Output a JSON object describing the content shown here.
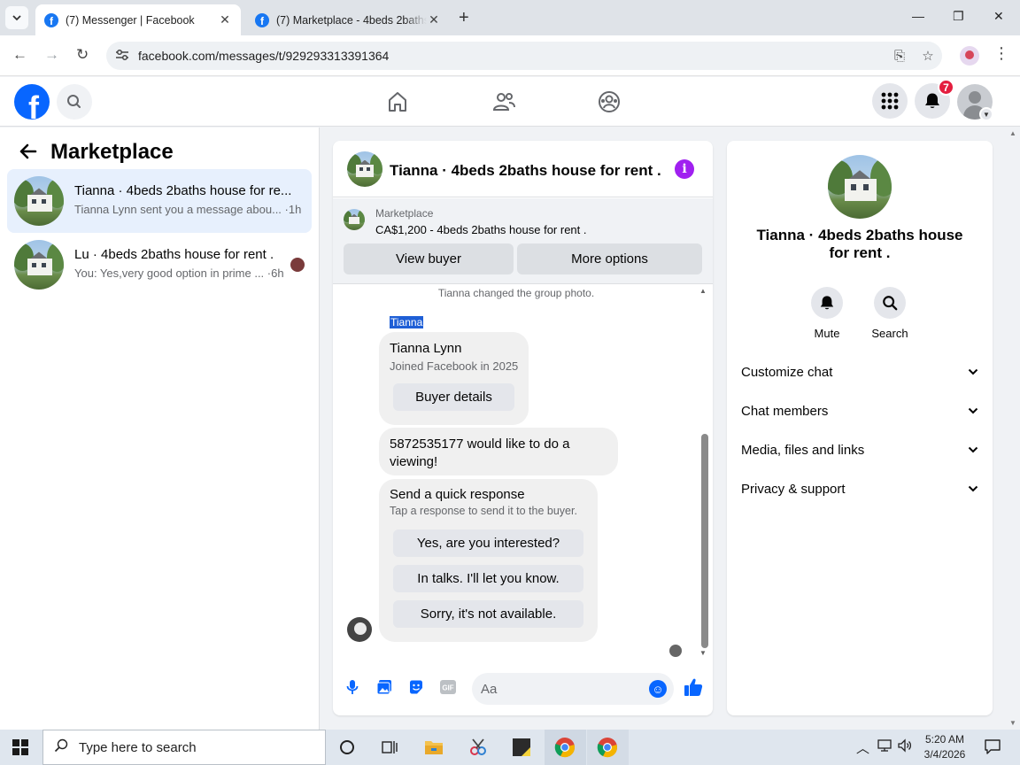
{
  "browser": {
    "tabs": [
      {
        "title": "(7) Messenger | Facebook",
        "active": true
      },
      {
        "title": "(7) Marketplace - 4beds 2baths",
        "active": false
      }
    ],
    "url": "facebook.com/messages/t/929293313391364"
  },
  "fb": {
    "logo": "f",
    "notification_count": "7"
  },
  "left": {
    "title": "Marketplace",
    "conversations": [
      {
        "name": "Tianna · 4beds 2baths house for re...",
        "preview": "Tianna Lynn sent you a message abou... ·1h",
        "selected": true
      },
      {
        "name": "Lu · 4beds 2baths house for rent .",
        "preview": "You: Yes,very good option in prime ... ·6h",
        "selected": false
      }
    ]
  },
  "chat": {
    "title": "Tianna · 4beds 2baths house for rent .",
    "listing_source": "Marketplace",
    "listing_price": "CA$1,200 - 4beds 2baths house for rent .",
    "view_buyer": "View buyer",
    "more_options": "More options",
    "system_message": "Tianna changed the group photo.",
    "sender_label": "Tianna",
    "buyer_card": {
      "name": "Tianna Lynn",
      "joined": "Joined Facebook in 2025",
      "button": "Buyer details"
    },
    "message": "5872535177 would like to do a viewing!",
    "quick_response": {
      "title": "Send a quick response",
      "subtitle": "Tap a response to send it to the buyer.",
      "options": [
        "Yes, are you interested?",
        "In talks. I'll let you know.",
        "Sorry, it's not available."
      ]
    },
    "composer_placeholder": "Aa"
  },
  "right": {
    "name": "Tianna · 4beds 2baths house for rent .",
    "actions": [
      {
        "label": "Mute",
        "icon": "bell-icon"
      },
      {
        "label": "Search",
        "icon": "search-icon"
      }
    ],
    "sections": [
      "Customize chat",
      "Chat members",
      "Media, files and links",
      "Privacy & support"
    ]
  },
  "taskbar": {
    "search_placeholder": "Type here to search",
    "time": "5:20 AM",
    "date": "3/4/2026"
  },
  "colors": {
    "facebook_blue": "#0866ff",
    "selected_conversation": "#e7f0fd",
    "badge_red": "#e41e3f",
    "info_purple": "#a020f0"
  }
}
